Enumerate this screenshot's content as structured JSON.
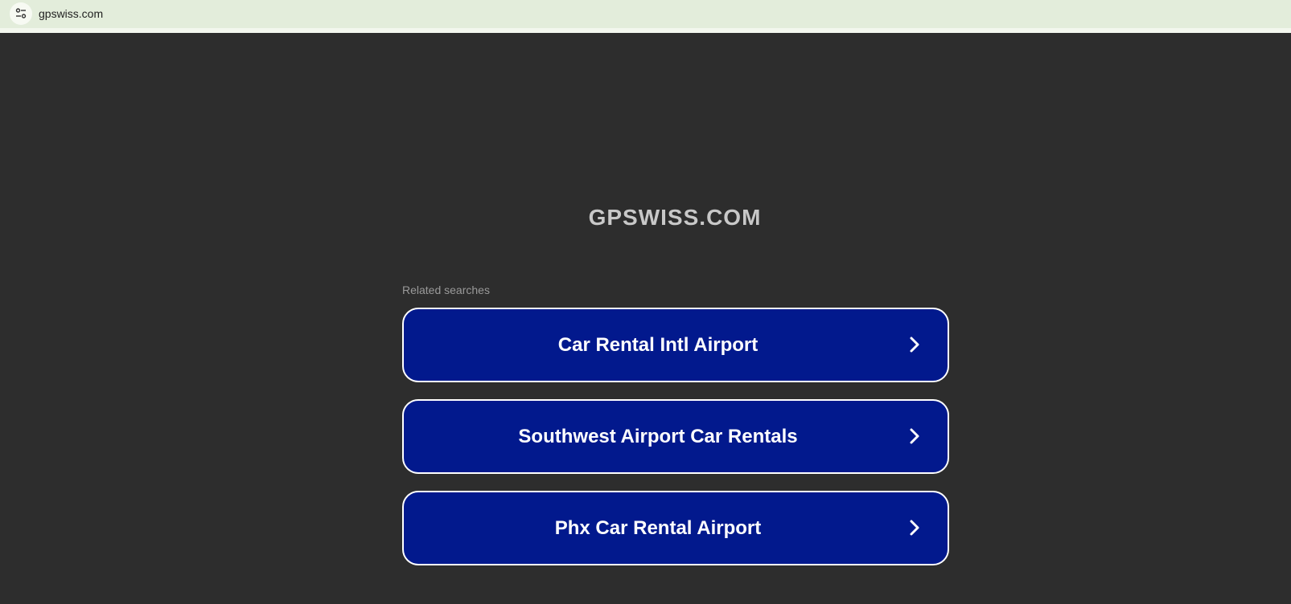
{
  "browser": {
    "url": "gpswiss.com",
    "site_info_icon": "tune-icon"
  },
  "page": {
    "title": "GPSWISS.COM",
    "related_label": "Related searches",
    "colors": {
      "background": "#2d2d2d",
      "button_bg": "#02198d",
      "button_border": "#ffffff",
      "title": "#c8c8c8"
    },
    "searches": [
      {
        "label": "Car Rental Intl Airport",
        "icon": "chevron-right-icon"
      },
      {
        "label": "Southwest Airport Car Rentals",
        "icon": "chevron-right-icon"
      },
      {
        "label": "Phx Car Rental Airport",
        "icon": "chevron-right-icon"
      }
    ]
  }
}
